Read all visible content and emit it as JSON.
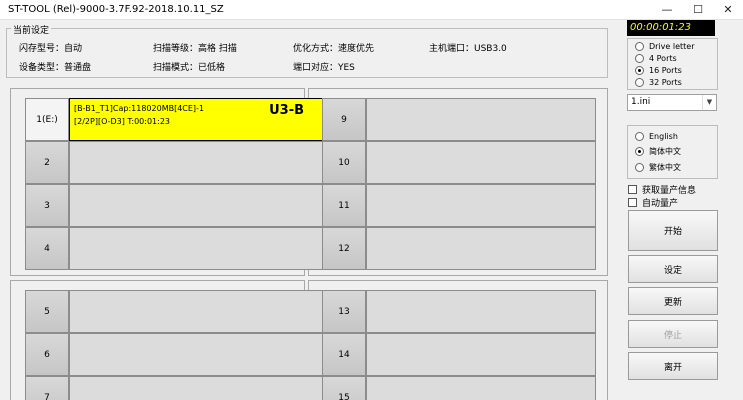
{
  "window": {
    "title": "ST-TOOL (Rel)-9000-3.7F.92-2018.10.11_SZ",
    "min": "—",
    "max": "☐",
    "close": "✕"
  },
  "settings": {
    "legend": "当前设定",
    "flash_model": "闪存型号：自动",
    "scan_level": "扫描等级：高格 扫描",
    "optimize": "优化方式：速度优先",
    "host_port": "主机端口：USB3.0",
    "device_type": "设备类型：普通盘",
    "scan_mode": "扫描模式：已低格",
    "port_map": "端口对应：YES"
  },
  "slots": [
    {
      "num": "1(E:)",
      "line1": "[B-B1_T1]Cap:118020MB[4CE]-1",
      "line2": "[2/2P][O-D3] T:00:01:23",
      "tag": "U3-B"
    },
    {
      "num": "2"
    },
    {
      "num": "3"
    },
    {
      "num": "4"
    },
    {
      "num": "5"
    },
    {
      "num": "6"
    },
    {
      "num": "7"
    },
    {
      "num": "9"
    },
    {
      "num": "10"
    },
    {
      "num": "11"
    },
    {
      "num": "12"
    },
    {
      "num": "13"
    },
    {
      "num": "14"
    },
    {
      "num": "15"
    }
  ],
  "timer": "00:00:01:23",
  "ports": {
    "options": [
      "Drive letter",
      "4 Ports",
      "16 Ports",
      "32 Ports"
    ],
    "selected": "16 Ports"
  },
  "ini_select": {
    "value": "1.ini"
  },
  "language": {
    "options": [
      "English",
      "简体中文",
      "繁体中文"
    ],
    "selected": "简体中文"
  },
  "checks": {
    "get_production_info": "获取量产信息",
    "auto_production": "自动量产"
  },
  "buttons": {
    "start": "开始",
    "setup": "设定",
    "refresh": "更新",
    "stop": "停止",
    "exit": "离开"
  }
}
